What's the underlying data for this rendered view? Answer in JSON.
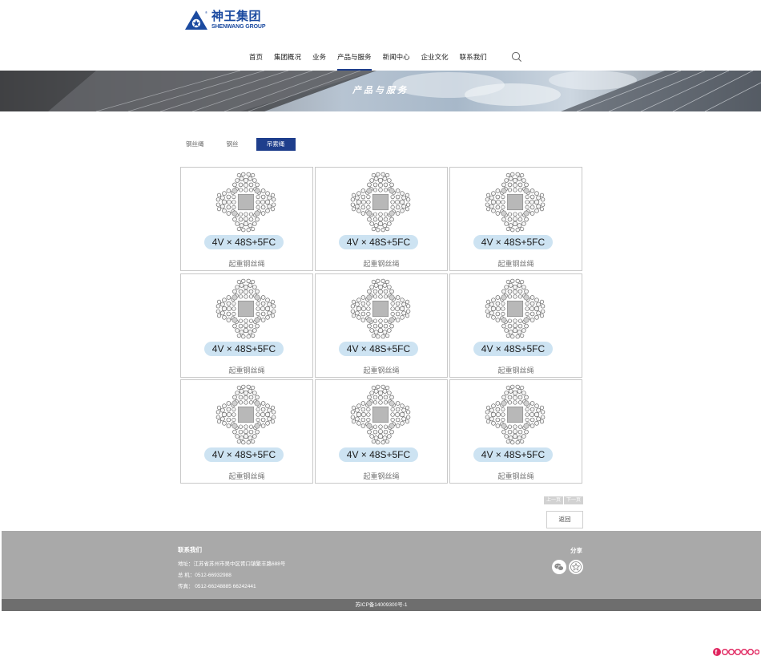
{
  "brand": {
    "name_cn": "神王集团",
    "name_en": "SHENWANG GROUP",
    "logo_color": "#1b4aa0"
  },
  "nav": {
    "items": [
      {
        "label": "首页"
      },
      {
        "label": "集团概况"
      },
      {
        "label": "业务"
      },
      {
        "label": "产品与服务",
        "active": true
      },
      {
        "label": "新闻中心"
      },
      {
        "label": "企业文化"
      },
      {
        "label": "联系我们"
      }
    ],
    "search_icon": "search-icon",
    "accent": "#1e3e8c"
  },
  "banner": {
    "title": "产品与服务"
  },
  "subtabs": [
    {
      "label": "钢丝绳"
    },
    {
      "label": "钢丝"
    },
    {
      "label": "吊索绳",
      "active": true
    }
  ],
  "products": [
    {
      "model": "4V × 48S+5FC",
      "name": "起重钢丝绳"
    },
    {
      "model": "4V × 48S+5FC",
      "name": "起重钢丝绳"
    },
    {
      "model": "4V × 48S+5FC",
      "name": "起重钢丝绳"
    },
    {
      "model": "4V × 48S+5FC",
      "name": "起重钢丝绳"
    },
    {
      "model": "4V × 48S+5FC",
      "name": "起重钢丝绳"
    },
    {
      "model": "4V × 48S+5FC",
      "name": "起重钢丝绳"
    },
    {
      "model": "4V × 48S+5FC",
      "name": "起重钢丝绳"
    },
    {
      "model": "4V × 48S+5FC",
      "name": "起重钢丝绳"
    },
    {
      "model": "4V × 48S+5FC",
      "name": "起重钢丝绳"
    }
  ],
  "pager": {
    "prev": "上一页",
    "next": "下一页",
    "back": "返回"
  },
  "footer": {
    "contact_title": "联系我们",
    "address": "地址：江苏省苏州市吴中区胥口镇繁丰路688号",
    "phone": "总 机：0512-66932988",
    "fax": "传真：  0512-66248885  66242441",
    "share_title": "分享",
    "share_icons": [
      "wechat-icon",
      "favorite-star-icon"
    ],
    "icp": "苏ICP备14009300号-1"
  },
  "watermark": {
    "text": "foodopoo",
    "color": "#e0245e"
  }
}
